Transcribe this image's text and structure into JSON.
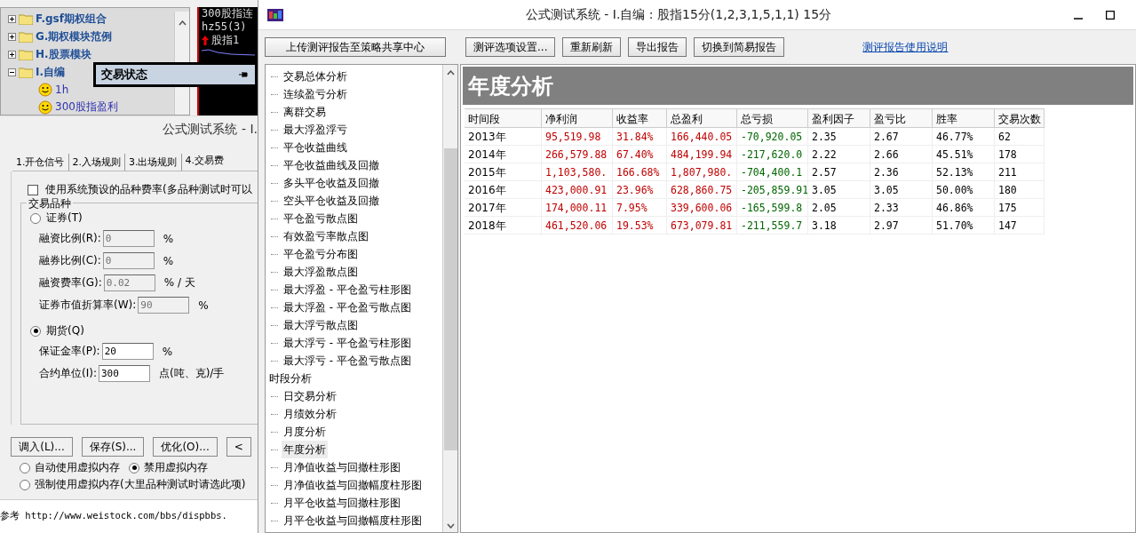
{
  "formula_tree": {
    "items": [
      {
        "label": "F.gsf期权组合",
        "kind": "folder",
        "expanded": false
      },
      {
        "label": "G.期权模块范例",
        "kind": "folder",
        "expanded": false
      },
      {
        "label": "H.股票模块",
        "kind": "folder",
        "expanded": false
      },
      {
        "label": "I.自编",
        "kind": "folder",
        "expanded": true,
        "children": [
          {
            "label": "1h",
            "kind": "formula"
          },
          {
            "label": "300股指盈利",
            "kind": "formula"
          }
        ]
      }
    ]
  },
  "chart_panel": {
    "lines": [
      "300股指连",
      "hz55(3)"
    ],
    "signal": "股指1"
  },
  "floating_panel": {
    "title": "交易状态"
  },
  "settings_dialog": {
    "title": "公式测试系统 - I.",
    "tabs": [
      {
        "label": "1.开仓信号",
        "selected": false
      },
      {
        "label": "2.入场规则",
        "selected": false
      },
      {
        "label": "3.出场规则",
        "selected": false
      },
      {
        "label": "4.交易费",
        "selected": true
      }
    ],
    "use_preset": {
      "label": "使用系统预设的品种费率(多品种测试时可以",
      "checked": false
    },
    "group": {
      "title": "交易品种",
      "options": [
        {
          "label": "证券(T)",
          "selected": false,
          "fields": [
            {
              "label": "融资比例(R):",
              "value": "0",
              "unit": "%",
              "disabled": true
            },
            {
              "label": "融券比例(C):",
              "value": "0",
              "unit": "%",
              "disabled": true
            },
            {
              "label": "融资费率(G):",
              "value": "0.02",
              "unit": "% / 天",
              "disabled": true
            },
            {
              "label": "证券市值折算率(W):",
              "value": "90",
              "unit": "%",
              "disabled": true
            }
          ]
        },
        {
          "label": "期货(Q)",
          "selected": true,
          "fields": [
            {
              "label": "保证金率(P):",
              "value": "20",
              "unit": "%",
              "disabled": false
            },
            {
              "label": "合约单位(I):",
              "value": "300",
              "unit": "点(吨、克)/手",
              "disabled": false
            }
          ]
        }
      ]
    },
    "buttons": [
      "调入(L)...",
      "保存(S)...",
      "优化(O)...",
      "<"
    ],
    "memory_options": [
      {
        "label": "自动使用虚拟内存",
        "selected": false
      },
      {
        "label": "禁用虚拟内存",
        "selected": true
      },
      {
        "label": "强制使用虚拟内存(大里品种测试时请选此项)",
        "selected": false
      }
    ]
  },
  "output": {
    "text": "参考 http://www.weistock.com/bbs/dispbbs."
  },
  "window": {
    "title": "公式测试系统 - I.自编 : 股指15分(1,2,3,1,5,1,1) 15分"
  },
  "toolbar": {
    "upload": "上传测评报告至策略共享中心",
    "buttons": [
      "测评选项设置...",
      "重新刷新",
      "导出报告",
      "切换到简易报告"
    ],
    "help_link": "测评报告使用说明"
  },
  "report_tree": [
    {
      "kind": "continued",
      "children": [
        {
          "label": "交易总体分析",
          "selected": false
        },
        {
          "label": "连续盈亏分析",
          "selected": false
        },
        {
          "label": "离群交易",
          "selected": false
        },
        {
          "label": "最大浮盈浮亏",
          "selected": false
        },
        {
          "label": "平仓收益曲线",
          "selected": false
        },
        {
          "label": "平仓收益曲线及回撤",
          "selected": false
        },
        {
          "label": "多头平仓收益及回撤",
          "selected": false
        },
        {
          "label": "空头平仓收益及回撤",
          "selected": false
        },
        {
          "label": "平仓盈亏散点图",
          "selected": false
        },
        {
          "label": "有效盈亏率散点图",
          "selected": false
        },
        {
          "label": "平仓盈亏分布图",
          "selected": false
        },
        {
          "label": "最大浮盈散点图",
          "selected": false
        },
        {
          "label": "最大浮盈 - 平仓盈亏柱形图",
          "selected": false
        },
        {
          "label": "最大浮盈 - 平仓盈亏散点图",
          "selected": false
        },
        {
          "label": "最大浮亏散点图",
          "selected": false
        },
        {
          "label": "最大浮亏 - 平仓盈亏柱形图",
          "selected": false
        },
        {
          "label": "最大浮亏 - 平仓盈亏散点图",
          "selected": false
        }
      ]
    },
    {
      "kind": "group",
      "label": "时段分析",
      "children": [
        {
          "label": "日交易分析",
          "selected": false
        },
        {
          "label": "月绩效分析",
          "selected": false
        },
        {
          "label": "月度分析",
          "selected": false
        },
        {
          "label": "年度分析",
          "selected": true
        },
        {
          "label": "月净值收益与回撤柱形图",
          "selected": false
        },
        {
          "label": "月净值收益与回撤幅度柱形图",
          "selected": false
        },
        {
          "label": "月平仓收益与回撤柱形图",
          "selected": false
        },
        {
          "label": "月平仓收益与回撤幅度柱形图",
          "selected": false
        }
      ]
    }
  ],
  "report": {
    "heading": "年度分析",
    "columns": [
      {
        "label": "时间段",
        "kind": "plain"
      },
      {
        "label": "净利润",
        "kind": "gain"
      },
      {
        "label": "收益率",
        "kind": "gain"
      },
      {
        "label": "总盈利",
        "kind": "gain"
      },
      {
        "label": "总亏损",
        "kind": "loss"
      },
      {
        "label": "盈利因子",
        "kind": "plain"
      },
      {
        "label": "盈亏比",
        "kind": "plain"
      },
      {
        "label": "胜率",
        "kind": "plain"
      },
      {
        "label": "交易次数",
        "kind": "plain"
      }
    ],
    "rows": [
      [
        "2013年",
        "95,519.98",
        "31.84%",
        "166,440.05",
        "-70,920.05",
        "2.35",
        "2.67",
        "46.77%",
        "62"
      ],
      [
        "2014年",
        "266,579.88",
        "67.40%",
        "484,199.94",
        "-217,620.0",
        "2.22",
        "2.66",
        "45.51%",
        "178"
      ],
      [
        "2015年",
        "1,103,580.",
        "166.68%",
        "1,807,980.",
        "-704,400.1",
        "2.57",
        "2.36",
        "52.13%",
        "211"
      ],
      [
        "2016年",
        "423,000.91",
        "23.96%",
        "628,860.75",
        "-205,859.91",
        "3.05",
        "3.05",
        "50.00%",
        "180"
      ],
      [
        "2017年",
        "174,000.11",
        "7.95%",
        "339,600.06",
        "-165,599.8",
        "2.05",
        "2.33",
        "46.86%",
        "175"
      ],
      [
        "2018年",
        "461,520.06",
        "19.53%",
        "673,079.81",
        "-211,559.7",
        "3.18",
        "2.97",
        "51.70%",
        "147"
      ]
    ]
  }
}
